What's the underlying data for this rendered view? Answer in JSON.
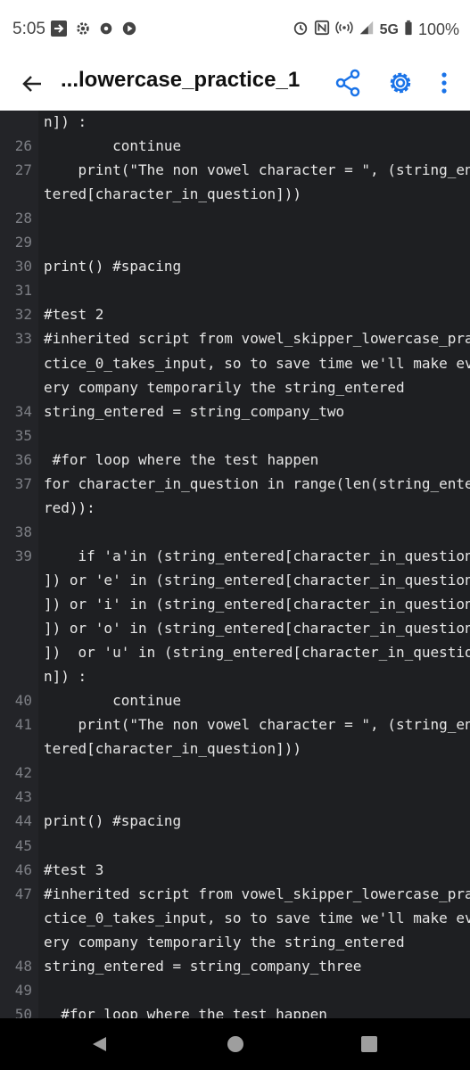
{
  "status": {
    "time": "5:05",
    "network": "5G",
    "battery": "100%",
    "left_icons": [
      "forward-box-icon",
      "gear-small-icon",
      "gear-filled-icon",
      "play-circle-icon"
    ],
    "right_icons": [
      "alarm-icon",
      "nfc-icon",
      "hotspot-icon",
      "signal-icon",
      "battery-icon"
    ]
  },
  "appbar": {
    "title": "...lowercase_practice_1",
    "actions": [
      "share-icon",
      "settings-icon",
      "more-vert-icon"
    ]
  },
  "editor": {
    "rows": [
      {
        "n": "",
        "code": "n]) :"
      },
      {
        "n": "26",
        "code": "        continue"
      },
      {
        "n": "27",
        "code": "    print(\"The non vowel character = \", (string_en"
      },
      {
        "n": "",
        "code": "tered[character_in_question]))"
      },
      {
        "n": "28",
        "code": ""
      },
      {
        "n": "29",
        "code": ""
      },
      {
        "n": "30",
        "code": "print() #spacing"
      },
      {
        "n": "31",
        "code": ""
      },
      {
        "n": "32",
        "code": "#test 2"
      },
      {
        "n": "33",
        "code": "#inherited script from vowel_skipper_lowercase_pra"
      },
      {
        "n": "",
        "code": "ctice_0_takes_input, so to save time we'll make ev"
      },
      {
        "n": "",
        "code": "ery company temporarily the string_entered"
      },
      {
        "n": "34",
        "code": "string_entered = string_company_two"
      },
      {
        "n": "35",
        "code": ""
      },
      {
        "n": "36",
        "code": " #for loop where the test happen"
      },
      {
        "n": "37",
        "code": "for character_in_question in range(len(string_ente"
      },
      {
        "n": "",
        "code": "red)):"
      },
      {
        "n": "38",
        "code": ""
      },
      {
        "n": "39",
        "code": "    if 'a'in (string_entered[character_in_question"
      },
      {
        "n": "",
        "code": "]) or 'e' in (string_entered[character_in_question"
      },
      {
        "n": "",
        "code": "]) or 'i' in (string_entered[character_in_question"
      },
      {
        "n": "",
        "code": "]) or 'o' in (string_entered[character_in_question"
      },
      {
        "n": "",
        "code": "])  or 'u' in (string_entered[character_in_questio"
      },
      {
        "n": "",
        "code": "n]) :"
      },
      {
        "n": "40",
        "code": "        continue"
      },
      {
        "n": "41",
        "code": "    print(\"The non vowel character = \", (string_en"
      },
      {
        "n": "",
        "code": "tered[character_in_question]))"
      },
      {
        "n": "42",
        "code": ""
      },
      {
        "n": "43",
        "code": ""
      },
      {
        "n": "44",
        "code": "print() #spacing"
      },
      {
        "n": "45",
        "code": ""
      },
      {
        "n": "46",
        "code": "#test 3"
      },
      {
        "n": "47",
        "code": "#inherited script from vowel_skipper_lowercase_pra"
      },
      {
        "n": "",
        "code": "ctice_0_takes_input, so to save time we'll make ev"
      },
      {
        "n": "",
        "code": "ery company temporarily the string_entered"
      },
      {
        "n": "48",
        "code": "string_entered = string_company_three"
      },
      {
        "n": "49",
        "code": ""
      },
      {
        "n": "50",
        "code": "  #for loop where the test happen"
      }
    ]
  },
  "navbar": {
    "buttons": [
      "back-triangle-icon",
      "home-circle-icon",
      "recents-square-icon"
    ]
  }
}
